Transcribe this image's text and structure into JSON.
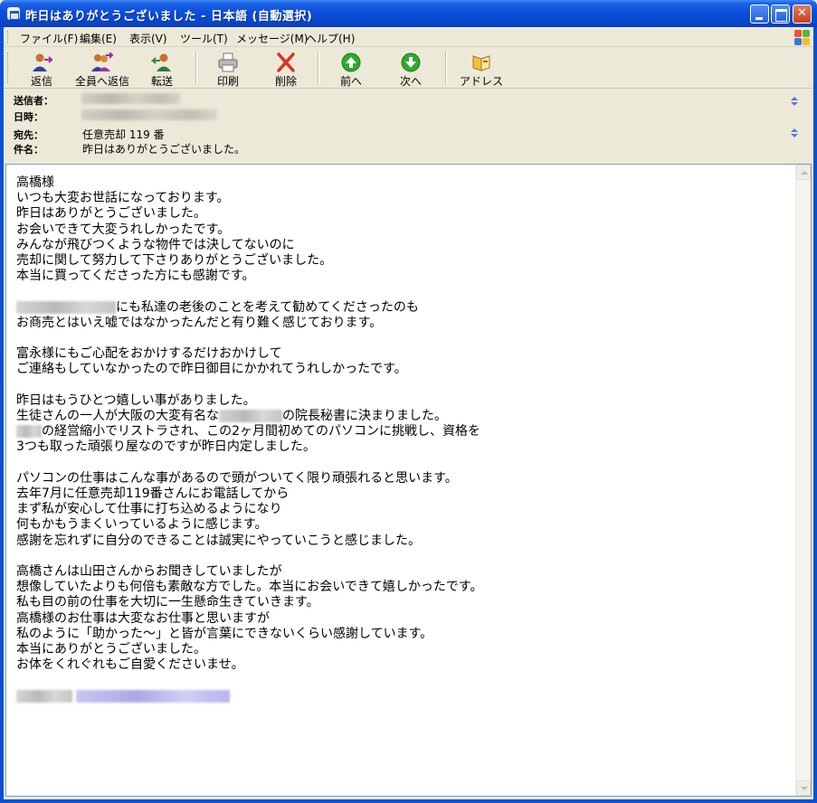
{
  "window": {
    "title": "昨日はありがとうございました - 日本語 (自動選択)"
  },
  "menu": [
    "ファイル(F)",
    "編集(E)",
    "表示(V)",
    "ツール(T)",
    "メッセージ(M)",
    "ヘルプ(H)"
  ],
  "toolbar": {
    "reply": "返信",
    "reply_all": "全員へ返信",
    "forward": "転送",
    "print": "印刷",
    "delete": "削除",
    "previous": "前へ",
    "next": "次へ",
    "addresses": "アドレス"
  },
  "headers": {
    "from_label": "送信者：",
    "date_label": "日時：",
    "to_label": "宛先：",
    "subject_label": "件名：",
    "to_value": "任意売却 119 番",
    "subject_value": "昨日はありがとうございました。"
  },
  "body": {
    "lines": [
      "高橋様",
      "いつも大変お世話になっております。",
      "昨日はありがとうございました。",
      "お会いできて大変うれしかったです。",
      "みんなが飛びつくような物件では決してないのに",
      "売却に関して努力して下さりありがとうございました。",
      "本当に買ってくださった方にも感謝です。",
      "",
      "にも私達の老後のことを考えて勧めてくださったのも",
      "お商売とはいえ嘘ではなかったんだと有り難く感じております。",
      "",
      "富永様にもご心配をおかけするだけおかけして",
      "ご連絡もしていなかったので昨日御目にかかれてうれしかったです。",
      "",
      "昨日はもうひとつ嬉しい事がありました。",
      "生徒さんの一人が大阪の大変有名な",
      "の院長秘書に決まりました。",
      "の経営縮小でリストラされ、この2ヶ月間初めてのパソコンに挑戦し、資格を",
      "3つも取った頑張り屋なのですが昨日内定しました。",
      "",
      "パソコンの仕事はこんな事があるので頭がついてく限り頑張れると思います。",
      "去年7月に任意売却119番さんにお電話してから",
      "まず私が安心して仕事に打ち込めるようになり",
      "何もかもうまくいっているように感じます。",
      "感謝を忘れずに自分のできることは誠実にやっていこうと感じました。",
      "",
      "高橋さんは山田さんからお聞きしていましたが",
      "想像していたよりも何倍も素敵な方でした。本当にお会いできて嬉しかったです。",
      "私も目の前の仕事を大切に一生懸命生きていきます。",
      "高橋様のお仕事は大変なお仕事と思いますが",
      "私のように「助かった～」と皆が言葉にできないくらい感謝しています。",
      "本当にありがとうございました。",
      "お体をくれぐれもご自愛くださいませ。"
    ]
  },
  "colors": {
    "titlebar": "#0b4fd9",
    "chrome": "#ece9d8",
    "body_bg": "#ffffff",
    "border": "#7f9db9"
  }
}
